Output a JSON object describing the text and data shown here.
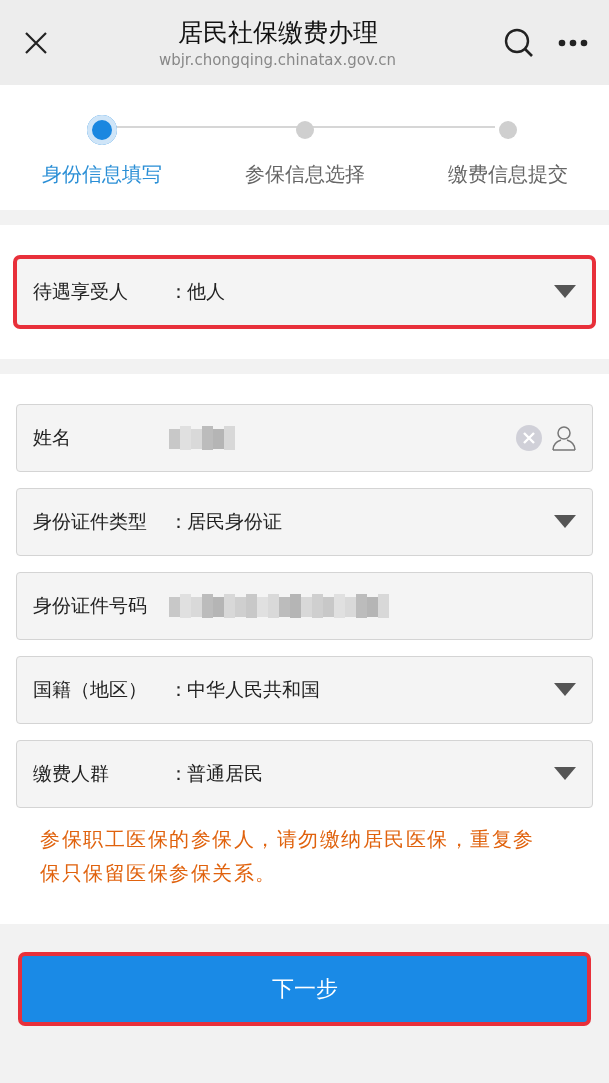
{
  "header": {
    "title": "居民社保缴费办理",
    "url": "wbjr.chongqing.chinatax.gov.cn"
  },
  "steps": [
    {
      "label": "身份信息填写",
      "selected": true
    },
    {
      "label": "参保信息选择",
      "selected": false
    },
    {
      "label": "缴费信息提交",
      "selected": false
    }
  ],
  "beneficiary": {
    "kind": "select",
    "label": "待遇享受人",
    "colon": "：",
    "value": "他人",
    "highlighted": true
  },
  "fields": [
    {
      "kind": "text",
      "label": "姓名",
      "redacted": true
    },
    {
      "kind": "select",
      "label": "身份证件类型",
      "colon": "：",
      "value": "居民身份证"
    },
    {
      "kind": "plain",
      "label": "身份证件号码",
      "redacted": true
    },
    {
      "kind": "select",
      "label": "国籍（地区）",
      "colon": "：",
      "value": "中华人民共和国"
    },
    {
      "kind": "select",
      "label": "缴费人群",
      "colon": "：",
      "value": "普通居民"
    }
  ],
  "notice": "参保职工医保的参保人，请勿缴纳居民医保，重复参保只保留医保参保关系。",
  "next_button": {
    "label": "下一步",
    "highlighted": true
  }
}
